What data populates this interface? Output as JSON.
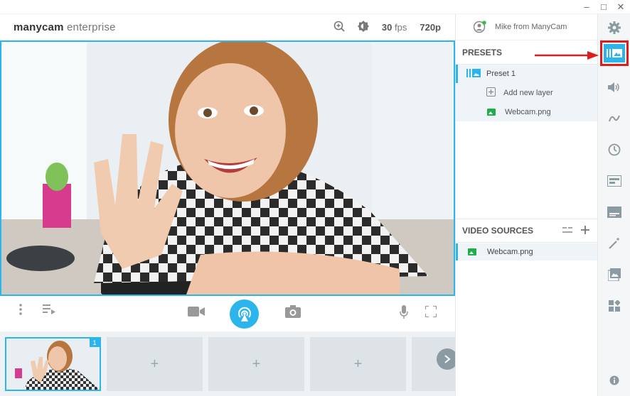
{
  "window": {
    "minimize": "–",
    "maximize": "□",
    "close": "✕"
  },
  "header": {
    "logo_bold": "manycam",
    "logo_light": "enterprise",
    "fps_value": "30",
    "fps_unit": "fps",
    "resolution": "720p"
  },
  "user": {
    "name": "Mike from ManyCam"
  },
  "presets": {
    "title": "PRESETS",
    "items": [
      {
        "label": "Preset 1"
      }
    ],
    "layers": [
      {
        "label": "Add new layer",
        "icon": "plus-square-icon"
      },
      {
        "label": "Webcam.png",
        "icon": "image-icon"
      }
    ]
  },
  "video_sources": {
    "title": "VIDEO SOURCES",
    "items": [
      {
        "label": "Webcam.png"
      }
    ]
  },
  "strip": {
    "active_badge": "1",
    "empty_tile": "+"
  },
  "colors": {
    "accent": "#2bb5ec",
    "highlight_red": "#e01b1b",
    "image_icon": "#1fae4c"
  }
}
